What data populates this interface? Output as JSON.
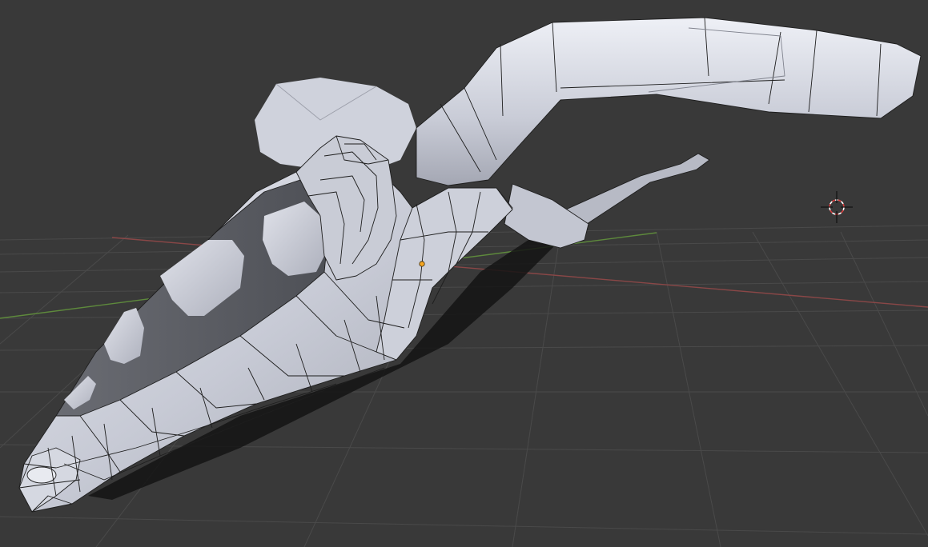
{
  "app": {
    "name": "3D viewport"
  },
  "viewport": {
    "background_color": "#393939",
    "grid_color": "#4a4a4a",
    "x_axis_color": "#8a4747",
    "y_axis_color": "#5e8a3c",
    "mesh_color_light": "#d9dbe3",
    "mesh_color_mid": "#b9bcc8",
    "mesh_color_dark": "#57595f",
    "wire_color": "#1e1e1e",
    "origin_color": "#f5a623",
    "cursor_colors": [
      "#d63d3d",
      "#ffffff"
    ]
  },
  "objects": {
    "mesh": "spaceship-mesh",
    "cursor": "3d-cursor-icon",
    "origin": "object-origin-dot"
  }
}
